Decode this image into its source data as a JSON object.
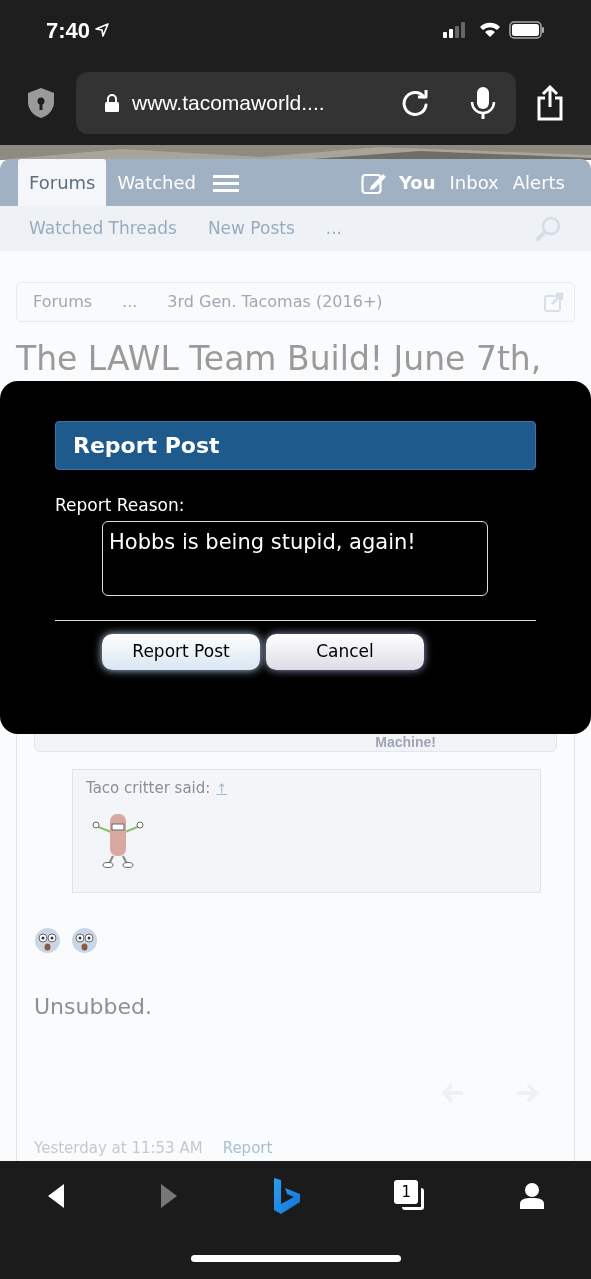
{
  "status_bar": {
    "time": "7:40"
  },
  "browser": {
    "url": "www.tacomaworld....",
    "tab_count": "1"
  },
  "nav": {
    "tabs": [
      {
        "label": "Forums",
        "selected": true
      },
      {
        "label": "Watched",
        "selected": false
      }
    ],
    "links": [
      "You",
      "Inbox",
      "Alerts"
    ]
  },
  "subnav": {
    "links": [
      "Watched Threads",
      "New Posts",
      "..."
    ]
  },
  "breadcrumb": [
    "Forums",
    "...",
    "3rd Gen. Tacomas (2016+)"
  ],
  "thread_title": "The LAWL Team Build! June 7th,",
  "dialog": {
    "title": "Report Post",
    "label": "Report Reason:",
    "value": "Hobbs is being stupid, again!",
    "buttons": [
      {
        "label": "Report Post",
        "primary": true
      },
      {
        "label": "Cancel",
        "primary": false
      }
    ]
  },
  "post": {
    "signature": "Machine!",
    "quote_author": "Taco critter said:",
    "quote_link": "↑",
    "body": "Unsubbed.",
    "date": "Yesterday at 11:53 AM",
    "report": "Report"
  }
}
